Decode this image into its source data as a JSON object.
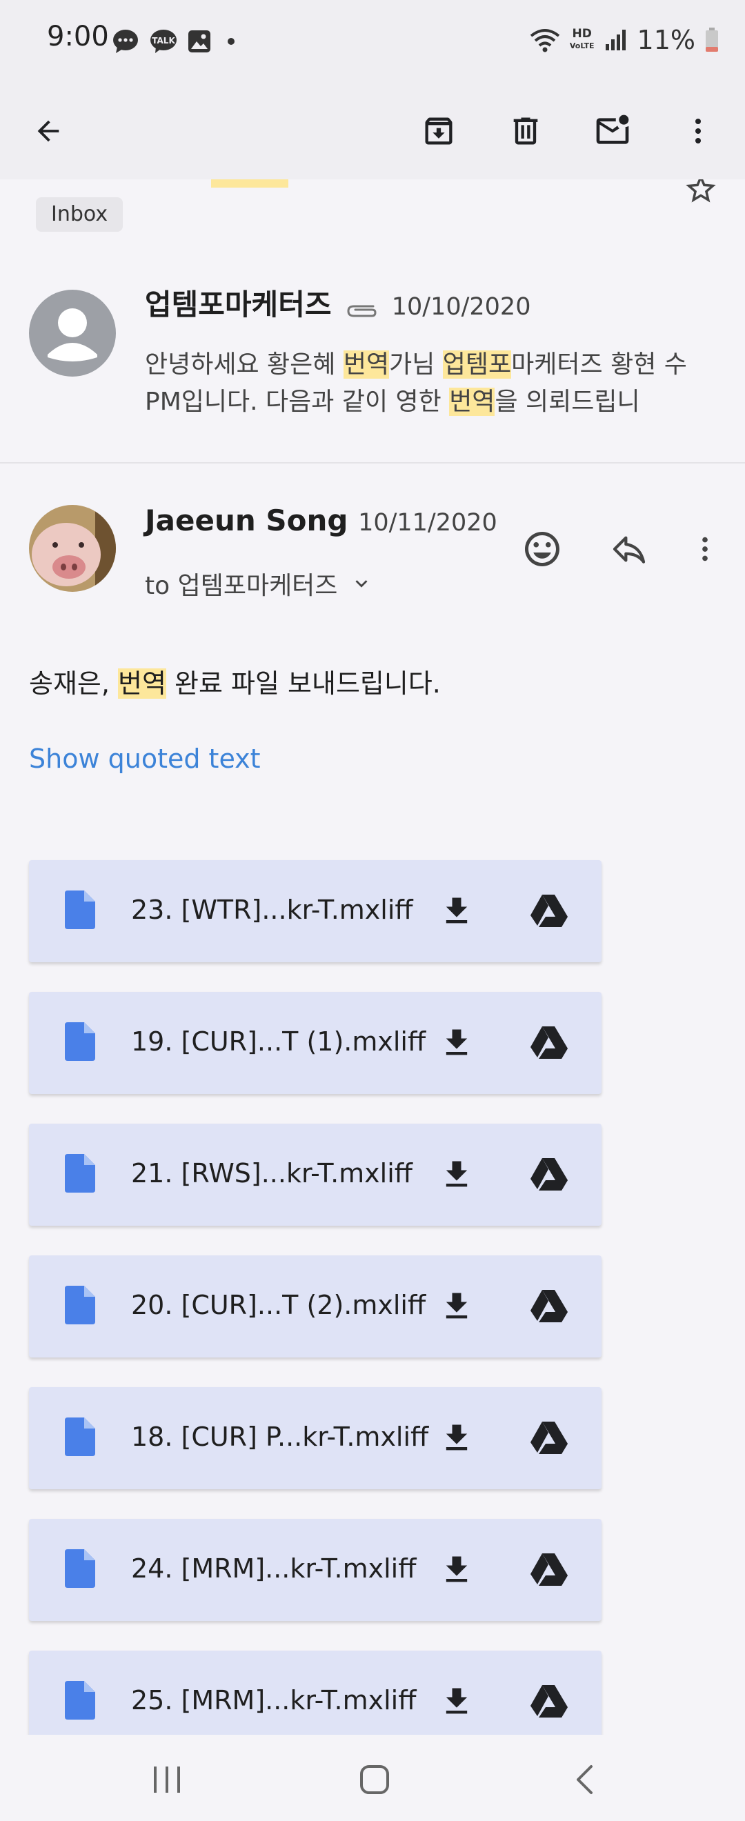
{
  "status_bar": {
    "time": "9:00",
    "battery": "11%",
    "hd_line1": "HD",
    "hd_line2": "VoLTE",
    "notification_icons": [
      "chat-bubble-icon",
      "kakaotalk-icon",
      "image-icon"
    ],
    "status_icons": [
      "wifi-icon",
      "hd-voice-icon",
      "signal-icon",
      "battery-icon"
    ]
  },
  "toolbar": {
    "icons": [
      "back-arrow-icon",
      "archive-icon",
      "delete-icon",
      "mark-unread-icon",
      "more-vert-icon"
    ]
  },
  "labels": {
    "inbox": "Inbox"
  },
  "message1": {
    "sender": "업템포마케터즈",
    "date": "10/10/2020",
    "has_attachment": true,
    "snippet_parts": [
      "안녕하세요 황은혜 ",
      "번역",
      "가님 ",
      "업템포",
      "마케터즈 황현 수PM입니다. 다음과 같이 영한 ",
      "번역",
      "을 의뢰드립니"
    ]
  },
  "message2": {
    "sender": "Jaeeun Song",
    "date": "10/11/2020",
    "to": "to 업템포마케터즈",
    "body_parts": [
      "송재은, ",
      "번역",
      " 완료 파일 보내드립니다."
    ],
    "show_quoted": "Show quoted text"
  },
  "attachments": [
    {
      "name": "23. [WTR]...kr-T.mxliff"
    },
    {
      "name": "19. [CUR]...T (1).mxliff"
    },
    {
      "name": "21. [RWS]...kr-T.mxliff"
    },
    {
      "name": "20. [CUR]...T (2).mxliff"
    },
    {
      "name": "18. [CUR] P...kr-T.mxliff"
    },
    {
      "name": "24. [MRM]...kr-T.mxliff"
    },
    {
      "name": "25. [MRM]...kr-T.mxliff"
    }
  ],
  "nav_bar": {
    "icons": [
      "recent-apps-icon",
      "home-icon",
      "back-icon"
    ]
  },
  "colors": {
    "highlight": "#fde79b",
    "link": "#3c83d8",
    "attachment_bg": "#dfe3f6",
    "file_icon": "#4a80e8"
  }
}
